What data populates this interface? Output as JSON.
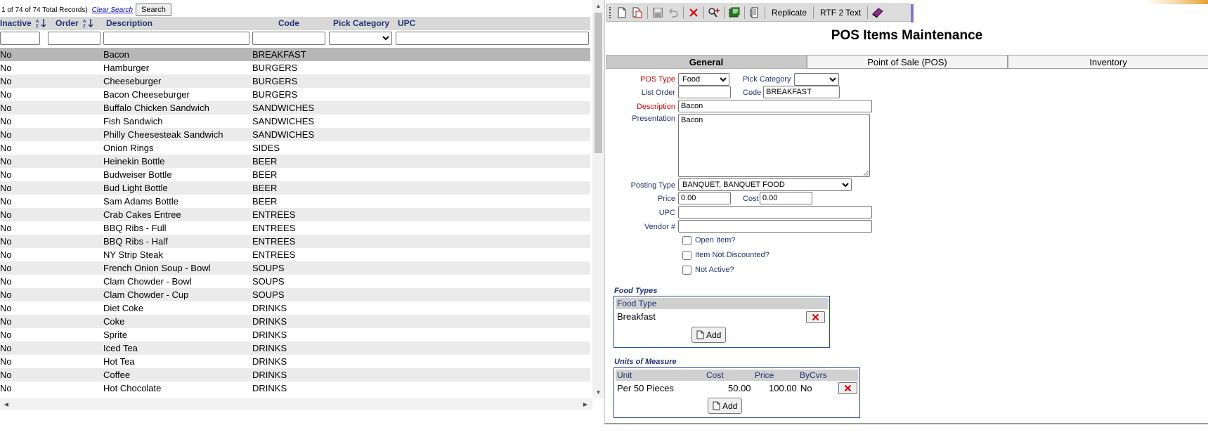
{
  "grid": {
    "record_count": "1 of 74 of 74 Total Records)",
    "clear_search": "Clear Search",
    "search_button": "Search",
    "headers": {
      "inactive": "Inactive",
      "order": "Order",
      "description": "Description",
      "code": "Code",
      "pick_category": "Pick Category",
      "upc": "UPC"
    },
    "sort_icon": "A-Z sort-icon",
    "rows": [
      {
        "inactive": "No",
        "description": "Bacon",
        "code": "BREAKFAST"
      },
      {
        "inactive": "No",
        "description": "Hamburger",
        "code": "BURGERS"
      },
      {
        "inactive": "No",
        "description": "Cheeseburger",
        "code": "BURGERS"
      },
      {
        "inactive": "No",
        "description": "Bacon Cheeseburger",
        "code": "BURGERS"
      },
      {
        "inactive": "No",
        "description": "Buffalo Chicken Sandwich",
        "code": "SANDWICHES"
      },
      {
        "inactive": "No",
        "description": "Fish Sandwich",
        "code": "SANDWICHES"
      },
      {
        "inactive": "No",
        "description": "Philly Cheesesteak Sandwich",
        "code": "SANDWICHES"
      },
      {
        "inactive": "No",
        "description": "Onion Rings",
        "code": "SIDES"
      },
      {
        "inactive": "No",
        "description": "Heinekin Bottle",
        "code": "BEER"
      },
      {
        "inactive": "No",
        "description": "Budweiser Bottle",
        "code": "BEER"
      },
      {
        "inactive": "No",
        "description": "Bud Light Bottle",
        "code": "BEER"
      },
      {
        "inactive": "No",
        "description": "Sam Adams Bottle",
        "code": "BEER"
      },
      {
        "inactive": "No",
        "description": "Crab Cakes Entree",
        "code": "ENTREES"
      },
      {
        "inactive": "No",
        "description": "BBQ Ribs - Full",
        "code": "ENTREES"
      },
      {
        "inactive": "No",
        "description": "BBQ Ribs - Half",
        "code": "ENTREES"
      },
      {
        "inactive": "No",
        "description": "NY Strip Steak",
        "code": "ENTREES"
      },
      {
        "inactive": "No",
        "description": "French Onion Soup - Bowl",
        "code": "SOUPS"
      },
      {
        "inactive": "No",
        "description": "Clam Chowder - Bowl",
        "code": "SOUPS"
      },
      {
        "inactive": "No",
        "description": "Clam Chowder - Cup",
        "code": "SOUPS"
      },
      {
        "inactive": "No",
        "description": "Diet Coke",
        "code": "DRINKS"
      },
      {
        "inactive": "No",
        "description": "Coke",
        "code": "DRINKS"
      },
      {
        "inactive": "No",
        "description": "Sprite",
        "code": "DRINKS"
      },
      {
        "inactive": "No",
        "description": "Iced Tea",
        "code": "DRINKS"
      },
      {
        "inactive": "No",
        "description": "Hot Tea",
        "code": "DRINKS"
      },
      {
        "inactive": "No",
        "description": "Coffee",
        "code": "DRINKS"
      },
      {
        "inactive": "No",
        "description": "Hot Chocolate",
        "code": "DRINKS"
      }
    ]
  },
  "toolbar": {
    "icons": [
      "new-document-icon",
      "copy-document-icon",
      "save-icon",
      "undo-icon",
      "delete-icon",
      "find-icon",
      "report-icon",
      "print-icon",
      "help-book-icon"
    ],
    "replicate": "Replicate",
    "rtf2text": "RTF 2 Text"
  },
  "form": {
    "title": "POS Items Maintenance",
    "tabs": [
      "General",
      "Point of Sale (POS)",
      "Inventory"
    ],
    "active_tab": "General",
    "labels": {
      "pos_type": "POS Type",
      "pick_category": "Pick Category",
      "list_order": "List Order",
      "code": "Code",
      "description": "Description",
      "presentation": "Presentation",
      "posting_type": "Posting Type",
      "price": "Price",
      "cost": "Cost",
      "upc": "UPC",
      "vendor": "Vendor #"
    },
    "values": {
      "pos_type": "Food",
      "pick_category": "",
      "list_order": "",
      "code": "BREAKFAST",
      "description": "Bacon",
      "presentation": "Bacon",
      "posting_type": "BANQUET, BANQUET FOOD",
      "price": "0.00",
      "cost": "0.00",
      "upc": "",
      "vendor": ""
    },
    "checkboxes": {
      "open_item": "Open Item?",
      "not_discounted": "Item Not Discounted?",
      "not_active": "Not Active?"
    },
    "food_types": {
      "title": "Food Types",
      "header": "Food Type",
      "rows": [
        "Breakfast"
      ],
      "add": "Add"
    },
    "units": {
      "title": "Units of Measure",
      "headers": {
        "unit": "Unit",
        "cost": "Cost",
        "price": "Price",
        "bycvrs": "ByCvrs"
      },
      "rows": [
        {
          "unit": "Per 50 Pieces",
          "cost": "50.00",
          "price": "100.00",
          "bycvrs": "No"
        }
      ],
      "add": "Add"
    }
  },
  "colors": {
    "label_blue": "#1f3473",
    "required_red": "#d80000",
    "selected_row": "#b7b7b7",
    "alt_row": "#ebebeb"
  }
}
